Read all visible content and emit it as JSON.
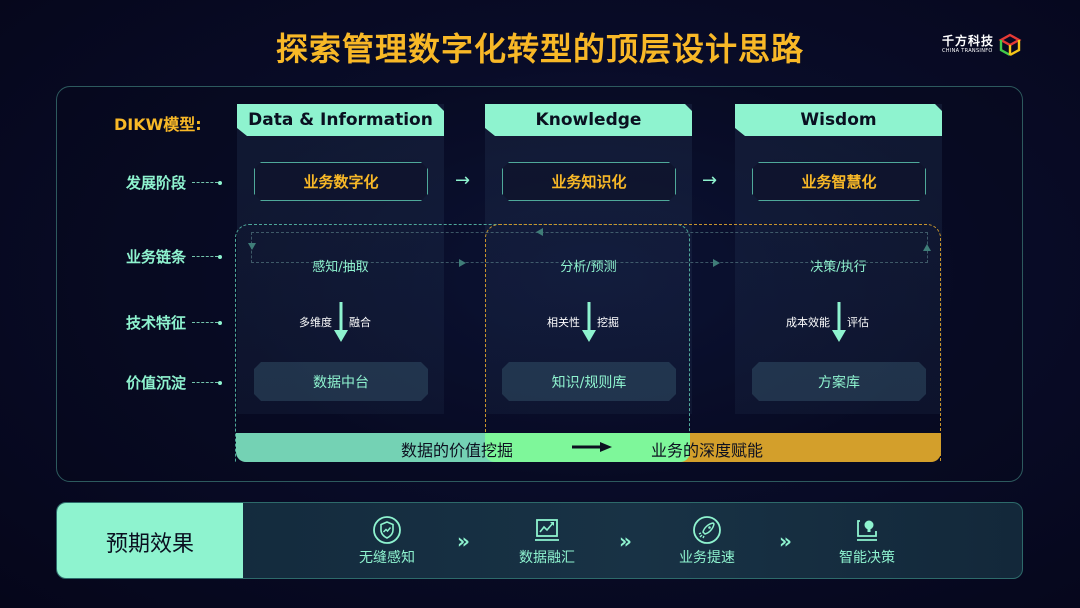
{
  "title": "探索管理数字化转型的顶层设计思路",
  "logo": {
    "cn": "千方科技",
    "en": "CHINA TRANSINFO",
    "icon": "cube-logo-icon"
  },
  "model_label": "DIKW模型:",
  "row_labels": [
    "发展阶段",
    "业务链条",
    "技术特征",
    "价值沉淀"
  ],
  "columns": [
    {
      "header": "Data & Information",
      "stage": "业务数字化",
      "chain": "感知/抽取",
      "tech_left": "多维度",
      "tech_right": "融合",
      "value": "数据中台"
    },
    {
      "header": "Knowledge",
      "stage": "业务知识化",
      "chain": "分析/预测",
      "tech_left": "相关性",
      "tech_right": "挖掘",
      "value": "知识/规则库"
    },
    {
      "header": "Wisdom",
      "stage": "业务智慧化",
      "chain": "决策/执行",
      "tech_left": "成本效能",
      "tech_right": "评估",
      "value": "方案库"
    }
  ],
  "stage_arrow": "→",
  "bottom_bar": {
    "left": "数据的价值挖掘",
    "right": "业务的深度赋能"
  },
  "effects": {
    "title": "预期效果",
    "items": [
      {
        "label": "无缝感知",
        "icon": "shield-trend-icon"
      },
      {
        "label": "数据融汇",
        "icon": "chart-monitor-icon"
      },
      {
        "label": "业务提速",
        "icon": "rocket-icon"
      },
      {
        "label": "智能决策",
        "icon": "lightbulb-laptop-icon"
      }
    ],
    "separator": "»"
  },
  "colors": {
    "accent": "#8ef3cf",
    "gold": "#f8b827",
    "orange": "#d39f2b",
    "green_bar": "#7ef79a"
  }
}
